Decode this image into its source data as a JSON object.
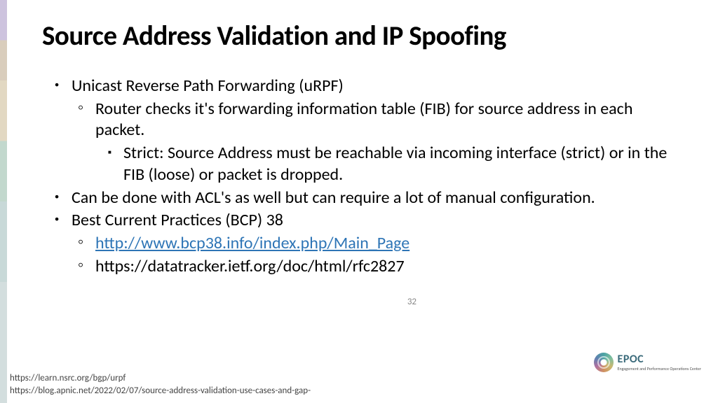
{
  "title": "Source Address Validation and IP Spoofing",
  "bullets": {
    "l1_0": "Unicast Reverse Path Forwarding (uRPF)",
    "l2_0": "Router checks it's forwarding information table (FIB) for source address in each packet.",
    "l3_0": "Strict: Source Address must be reachable via incoming interface (strict) or in the FIB (loose) or packet is dropped.",
    "l1_1": "Can be done with ACL's as well but can require a lot of manual configuration.",
    "l1_2": "Best Current Practices (BCP) 38",
    "l2_link": "http://www.bcp38.info/index.php/Main_Page",
    "l2_1": "https://datatracker.ietf.org/doc/html/rfc2827"
  },
  "footer": {
    "ref1": "https://learn.nsrc.org/bgp/urpf",
    "ref2": "https://blog.apnic.net/2022/02/07/source-address-validation-use-cases-and-gap-"
  },
  "slide_number": "32",
  "logo": {
    "name": "EPOC",
    "tagline": "Engagement and Performance Operations Center"
  }
}
